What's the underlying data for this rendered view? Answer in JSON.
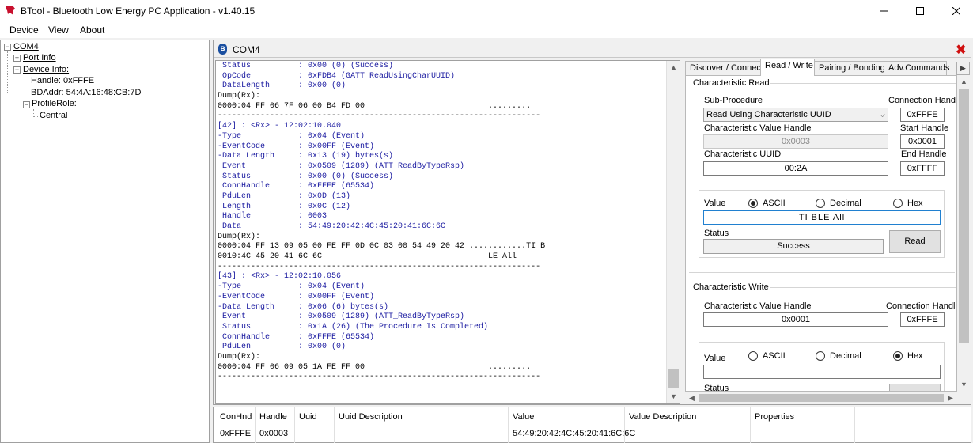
{
  "window": {
    "title": "BTool - Bluetooth Low Energy PC Application - v1.40.15"
  },
  "menu": {
    "device": "Device",
    "view": "View",
    "about": "About"
  },
  "tree": {
    "root": "COM4",
    "port_info": "Port Info",
    "device_info": "Device Info:",
    "handle": "Handle: 0xFFFE",
    "bdaddr": "BDAddr: 54:4A:16:48:CB:7D",
    "profile_role": "ProfileRole:",
    "central": "Central"
  },
  "com_panel": {
    "title": "COM4"
  },
  "log_lines": [
    {
      "t": " Status          : 0x00 (0) (Success)",
      "c": "blue"
    },
    {
      "t": " OpCode          : 0xFDB4 (GATT_ReadUsingCharUUID)",
      "c": "blue"
    },
    {
      "t": " DataLength      : 0x00 (0)",
      "c": "blue"
    },
    {
      "t": "Dump(Rx):",
      "c": "black"
    },
    {
      "t": "0000:04 FF 06 7F 06 00 B4 FD 00                          .........",
      "c": "black"
    },
    {
      "t": "--------------------------------------------------------------------",
      "c": "black"
    },
    {
      "t": "[42] : <Rx> - 12:02:10.040",
      "c": "blue"
    },
    {
      "t": "-Type            : 0x04 (Event)",
      "c": "blue"
    },
    {
      "t": "-EventCode       : 0x00FF (Event)",
      "c": "blue"
    },
    {
      "t": "-Data Length     : 0x13 (19) bytes(s)",
      "c": "blue"
    },
    {
      "t": " Event           : 0x0509 (1289) (ATT_ReadByTypeRsp)",
      "c": "blue"
    },
    {
      "t": " Status          : 0x00 (0) (Success)",
      "c": "blue"
    },
    {
      "t": " ConnHandle      : 0xFFFE (65534)",
      "c": "blue"
    },
    {
      "t": " PduLen          : 0x0D (13)",
      "c": "blue"
    },
    {
      "t": " Length          : 0x0C (12)",
      "c": "blue"
    },
    {
      "t": " Handle          : 0003",
      "c": "blue"
    },
    {
      "t": " Data            : 54:49:20:42:4C:45:20:41:6C:6C",
      "c": "blue"
    },
    {
      "t": "Dump(Rx):",
      "c": "black"
    },
    {
      "t": "0000:04 FF 13 09 05 00 FE FF 0D 0C 03 00 54 49 20 42 ............TI B",
      "c": "black"
    },
    {
      "t": "0010:4C 45 20 41 6C 6C                                   LE All",
      "c": "black"
    },
    {
      "t": "--------------------------------------------------------------------",
      "c": "black"
    },
    {
      "t": "[43] : <Rx> - 12:02:10.056",
      "c": "blue"
    },
    {
      "t": "-Type            : 0x04 (Event)",
      "c": "blue"
    },
    {
      "t": "-EventCode       : 0x00FF (Event)",
      "c": "blue"
    },
    {
      "t": "-Data Length     : 0x06 (6) bytes(s)",
      "c": "blue"
    },
    {
      "t": " Event           : 0x0509 (1289) (ATT_ReadByTypeRsp)",
      "c": "blue"
    },
    {
      "t": " Status          : 0x1A (26) (The Procedure Is Completed)",
      "c": "blue"
    },
    {
      "t": " ConnHandle      : 0xFFFE (65534)",
      "c": "blue"
    },
    {
      "t": " PduLen          : 0x00 (0)",
      "c": "blue"
    },
    {
      "t": "Dump(Rx):",
      "c": "black"
    },
    {
      "t": "0000:04 FF 06 09 05 1A FE FF 00                          .........",
      "c": "black"
    },
    {
      "t": "--------------------------------------------------------------------",
      "c": "black"
    }
  ],
  "tabs": [
    "Discover / Connect",
    "Read / Write",
    "Pairing / Bonding",
    "Adv.Commands"
  ],
  "read": {
    "group_title": "Characteristic Read",
    "sub_procedure_label": "Sub-Procedure",
    "sub_procedure_value": "Read Using Characteristic UUID",
    "connection_handle_label": "Connection Handle",
    "connection_handle_value": "0xFFFE",
    "char_value_handle_label": "Characteristic Value Handle",
    "char_value_handle_value": "0x0003",
    "start_handle_label": "Start Handle",
    "start_handle_value": "0x0001",
    "char_uuid_label": "Characteristic UUID",
    "char_uuid_value": "00:2A",
    "end_handle_label": "End Handle",
    "end_handle_value": "0xFFFF",
    "value_label": "Value",
    "radio_ascii": "ASCII",
    "radio_decimal": "Decimal",
    "radio_hex": "Hex",
    "value_text": "TI BLE All",
    "status_label": "Status",
    "status_value": "Success",
    "read_button": "Read"
  },
  "write": {
    "group_title": "Characteristic Write",
    "char_value_handle_label": "Characteristic Value Handle",
    "char_value_handle_value": "0x0001",
    "connection_handle_label": "Connection Handle",
    "connection_handle_value": "0xFFFE",
    "value_label": "Value",
    "radio_ascii": "ASCII",
    "radio_decimal": "Decimal",
    "radio_hex": "Hex",
    "status_label": "Status"
  },
  "table": {
    "headers": [
      "ConHnd",
      "Handle",
      "Uuid",
      "Uuid Description",
      "Value",
      "Value Description",
      "Properties"
    ],
    "row": [
      "0xFFFE",
      "0x0003",
      "",
      "",
      "54:49:20:42:4C:45:20:41:6C:6C",
      "",
      ""
    ]
  }
}
